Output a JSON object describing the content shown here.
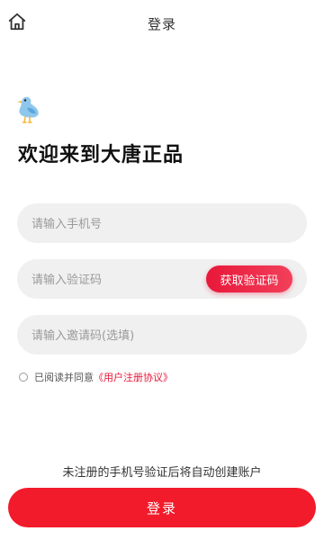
{
  "header": {
    "title": "登录",
    "home_icon": "home-icon"
  },
  "mascot_icon": "bird-mascot-icon",
  "welcome": "欢迎来到大唐正品",
  "form": {
    "phone": {
      "placeholder": "请输入手机号",
      "value": ""
    },
    "code": {
      "placeholder": "请输入验证码",
      "value": "",
      "button": "获取验证码"
    },
    "invite": {
      "placeholder": "请输入邀请码(选填)",
      "value": ""
    }
  },
  "agreement": {
    "checked": false,
    "text": "已阅读并同意",
    "link": "《用户注册协议》"
  },
  "notice": "未注册的手机号验证后将自动创建账户",
  "login_button": "登录",
  "colors": {
    "accent": "#e8183a",
    "login_button": "#f21b2b",
    "input_background": "#f0f0f0"
  }
}
